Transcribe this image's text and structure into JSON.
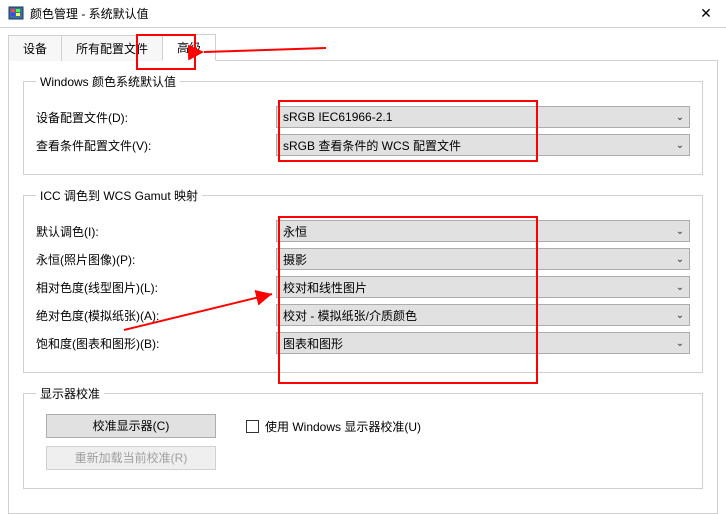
{
  "window": {
    "title": "颜色管理 - 系统默认值"
  },
  "tabs": {
    "devices": "设备",
    "all_profiles": "所有配置文件",
    "advanced": "高级"
  },
  "group1": {
    "legend": "Windows 颜色系统默认值",
    "device_profile_label": "设备配置文件(D):",
    "device_profile_value": "sRGB IEC61966-2.1",
    "view_profile_label": "查看条件配置文件(V):",
    "view_profile_value": "sRGB 查看条件的 WCS 配置文件"
  },
  "group2": {
    "legend": "ICC 调色到 WCS Gamut 映射",
    "default_intent_label": "默认调色(I):",
    "default_intent_value": "永恒",
    "perceptual_label": "永恒(照片图像)(P):",
    "perceptual_value": "摄影",
    "relative_label": "相对色度(线型图片)(L):",
    "relative_value": "校对和线性图片",
    "absolute_label": "绝对色度(模拟纸张)(A):",
    "absolute_value": "校对 - 模拟纸张/介质颜色",
    "saturation_label": "饱和度(图表和图形)(B):",
    "saturation_value": "图表和图形"
  },
  "group3": {
    "legend": "显示器校准",
    "calibrate_btn": "校准显示器(C)",
    "use_windows_calib": "使用 Windows 显示器校准(U)",
    "reload_btn": "重新加载当前校准(R)"
  }
}
